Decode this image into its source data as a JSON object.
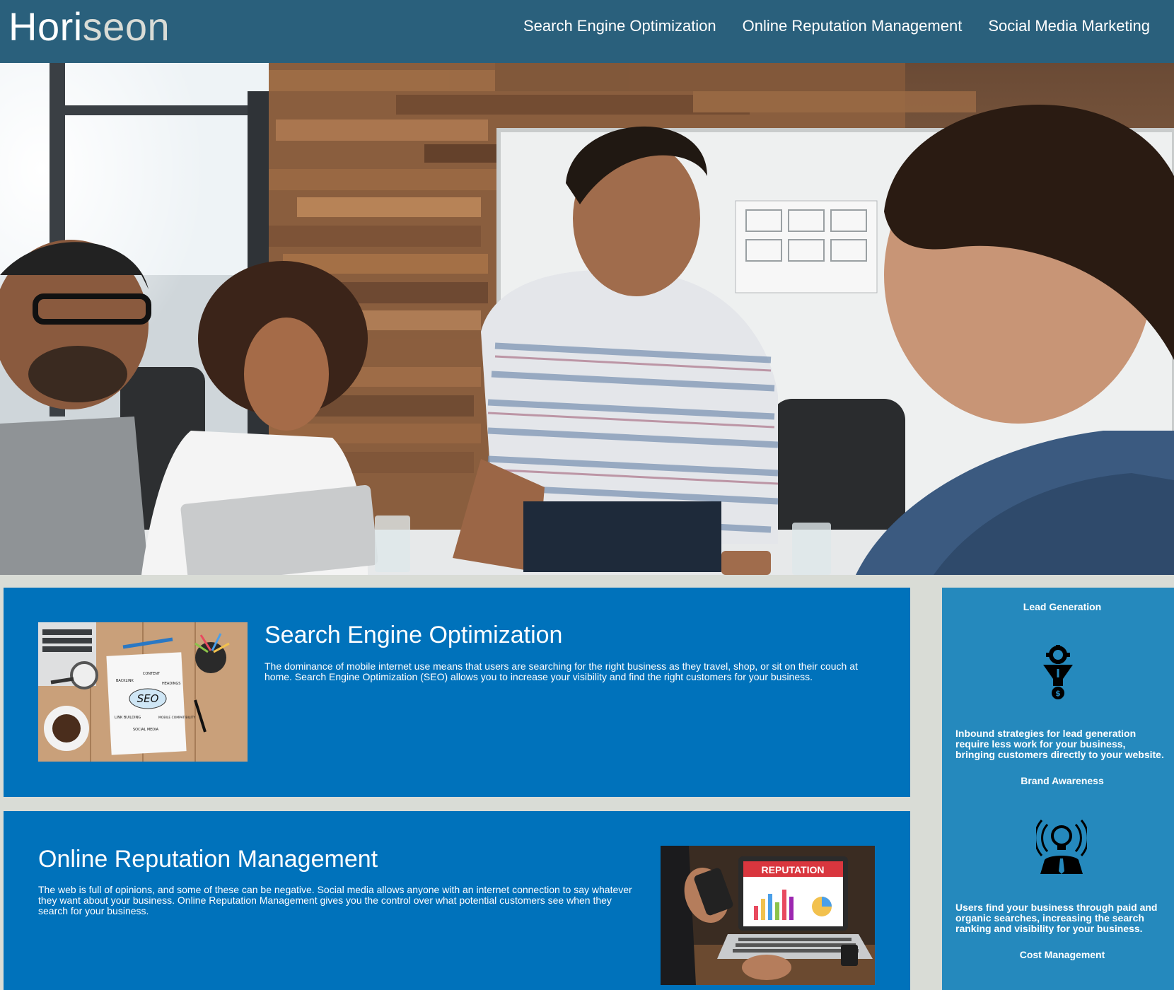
{
  "header": {
    "logo_main": "Hori",
    "logo_accent": "seon",
    "nav": [
      "Search Engine Optimization",
      "Online Reputation Management",
      "Social Media Marketing"
    ]
  },
  "sections": {
    "seo": {
      "title": "Search Engine Optimization",
      "text": "The dominance of mobile internet use means that users are searching for the right business as they travel, shop, or sit on their couch at home. Search Engine Optimization (SEO) allows you to increase your visibility and find the right customers for your business.",
      "image_labels": {
        "center": "SEO",
        "top": "CONTENT",
        "backlink": "BACKLINK",
        "headings": "HEADINGS",
        "link": "LINK BUILDING",
        "mobile": "MOBILE COMPATIBILITY",
        "social": "SOCIAL MEDIA"
      }
    },
    "orm": {
      "title": "Online Reputation Management",
      "text": "The web is full of opinions, and some of these can be negative. Social media allows anyone with an internet connection to say whatever they want about your business. Online Reputation Management gives you the control over what potential customers see when they search for your business.",
      "image_label": "REPUTATION"
    }
  },
  "sidebar": {
    "items": [
      {
        "title": "Lead Generation",
        "icon": "funnel-gear-icon",
        "text": "Inbound strategies for lead generation require less work for your business, bringing customers directly to your website."
      },
      {
        "title": "Brand Awareness",
        "icon": "lightbulb-broadcast-icon",
        "text": "Users find your business through paid and organic searches, increasing the search ranking and visibility for your business."
      },
      {
        "title": "Cost Management"
      }
    ]
  },
  "colors": {
    "header_bg": "#2a607c",
    "card_bg": "#0072bb",
    "sidebar_bg": "#2589bd",
    "page_bg": "#d9dcd6",
    "logo_accent": "#d9dcd6"
  }
}
